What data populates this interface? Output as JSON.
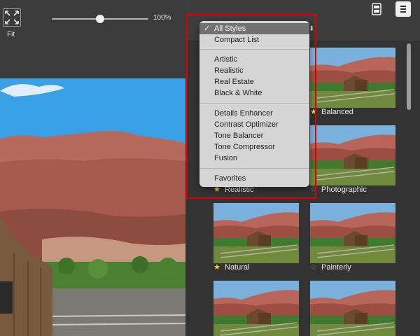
{
  "toolbar": {
    "fit_label": "Fit",
    "zoom_value": "100%",
    "zoom_level": 0.5
  },
  "style_menu": {
    "selected_index": 0,
    "items": [
      "All Styles",
      "Compact List",
      "Artistic",
      "Realistic",
      "Real Estate",
      "Black & White",
      "Details Enhancer",
      "Contrast Optimizer",
      "Tone Balancer",
      "Tone Compressor",
      "Fusion",
      "Favorites"
    ]
  },
  "presets": [
    {
      "label": "Balanced",
      "favorite": true
    },
    {
      "label": "Realistic",
      "favorite": true
    },
    {
      "label": "Photographic",
      "favorite": false
    },
    {
      "label": "Natural",
      "favorite": true
    },
    {
      "label": "Painterly",
      "favorite": false
    }
  ],
  "colors": {
    "panel_bg": "#333333",
    "menu_selected": "#727272",
    "star_favorite": "#f3d12c",
    "annotation_outline": "#e00000"
  },
  "icons": {
    "fit": "fit-to-screen-icon",
    "compare": "compare-view-icon",
    "menu": "hamburger-menu-icon",
    "star": "star-icon",
    "checkmark": "checkmark-icon"
  }
}
